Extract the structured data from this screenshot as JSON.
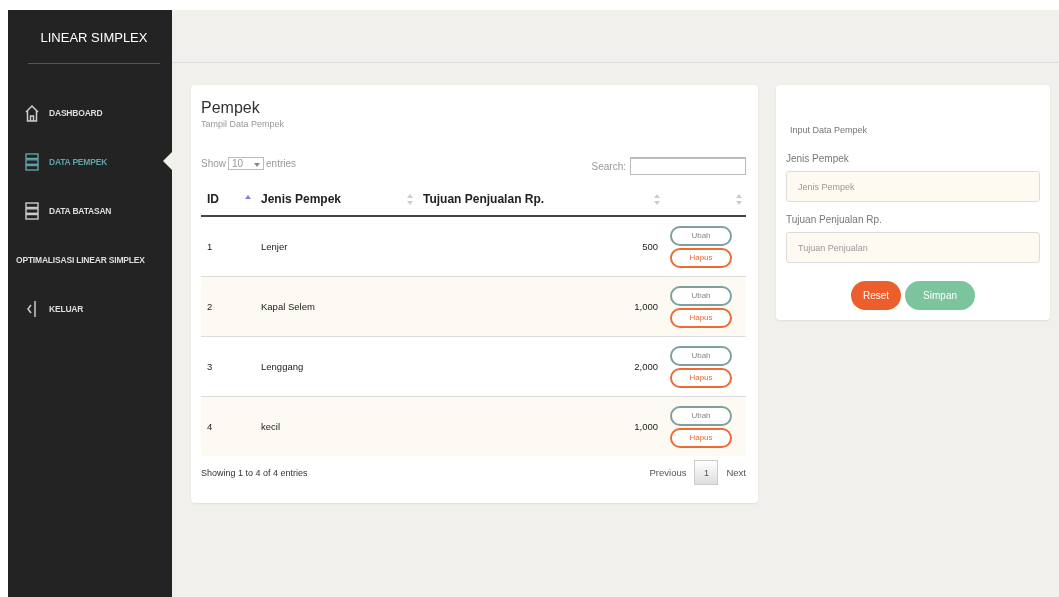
{
  "sidebar": {
    "brand": "LINEAR SIMPLEX",
    "items": [
      {
        "label": "DASHBOARD",
        "kind": "home",
        "selected": false
      },
      {
        "label": "DATA PEMPEK",
        "kind": "data",
        "selected": true
      },
      {
        "label": "DATA BATASAN",
        "kind": "data",
        "selected": false
      },
      {
        "label": "OPTIMALISASI LINEAR SIMPLEX",
        "kind": "text",
        "selected": false
      },
      {
        "label": "KELUAR",
        "kind": "exit",
        "selected": false
      }
    ]
  },
  "table_card": {
    "title": "Pempek",
    "subtitle": "Tampil Data Pempek",
    "length_label_before": "Show",
    "length_value": "10",
    "length_label_after": "entries",
    "search_label": "Search:",
    "columns": [
      {
        "label": "ID",
        "sorted": true
      },
      {
        "label": "Jenis Pempek",
        "sorted": false
      },
      {
        "label": "Tujuan Penjualan Rp.",
        "sorted": false
      },
      {
        "sorted": false
      }
    ],
    "rows": [
      {
        "id": "1",
        "name": "Lenjer",
        "target": "500",
        "edit": "Ubah",
        "delete": "Hapus"
      },
      {
        "id": "2",
        "name": "Kapal Selem",
        "target": "1,000",
        "edit": "Ubah",
        "delete": "Hapus"
      },
      {
        "id": "3",
        "name": "Lenggang",
        "target": "2,000",
        "edit": "Ubah",
        "delete": "Hapus"
      },
      {
        "id": "4",
        "name": "kecil",
        "target": "1,000",
        "edit": "Ubah",
        "delete": "Hapus"
      }
    ],
    "info": "Showing 1 to 4 of 4 entries",
    "pagination": {
      "previous": "Previous",
      "pages": [
        {
          "label": "1",
          "selected": true
        }
      ],
      "next": "Next"
    }
  },
  "form_card": {
    "title": "Input Data Pempek",
    "fields": [
      {
        "label": "Jenis Pempek",
        "placeholder": "Jenis Pempek"
      },
      {
        "label": "Tujuan Penjualan Rp.",
        "placeholder": "Tujuan Penjualan"
      }
    ],
    "buttons": [
      {
        "label": "Reset",
        "kind": "reset"
      },
      {
        "label": "Simpan",
        "kind": "save"
      }
    ]
  }
}
